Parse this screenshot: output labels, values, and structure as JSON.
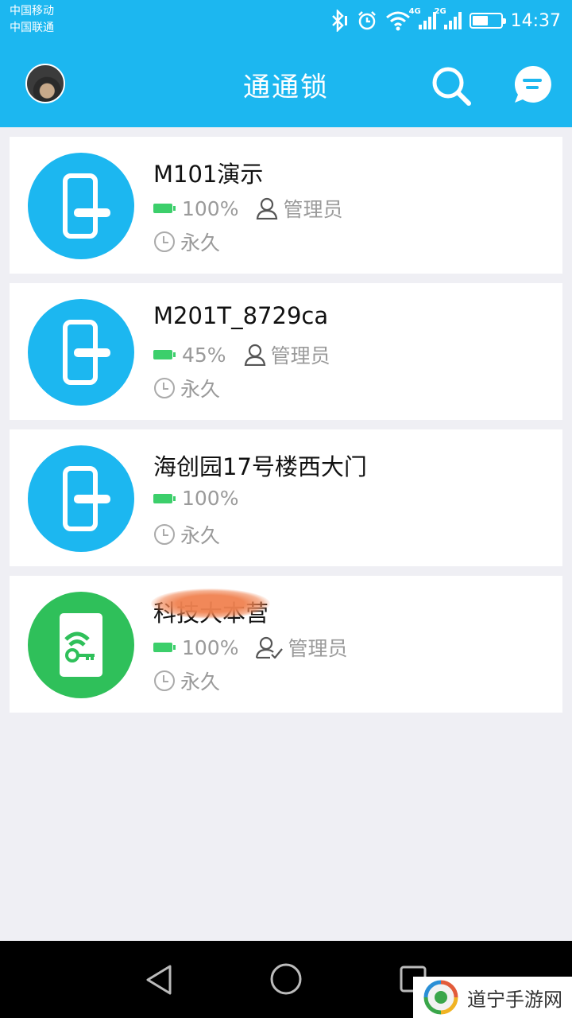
{
  "status_bar": {
    "carrier_1": "中国移动",
    "carrier_2": "中国联通",
    "network_1": "4G",
    "network_2": "2G",
    "time": "14:37",
    "battery_level": 0.55,
    "icons": [
      "bluetooth-icon",
      "alarm-icon",
      "wifi-icon",
      "signal-icon",
      "battery-icon"
    ]
  },
  "app_bar": {
    "title": "通通锁",
    "left_icon": "avatar",
    "right_icons": [
      "search-icon",
      "message-icon"
    ]
  },
  "locks": [
    {
      "name": "M101演示",
      "battery": "100%",
      "role": "管理员",
      "validity": "永久",
      "icon": "door-lock-icon",
      "color": "#1cb7f0"
    },
    {
      "name": "M201T_8729ca",
      "battery": "45%",
      "role": "管理员",
      "validity": "永久",
      "icon": "door-lock-icon",
      "color": "#1cb7f0"
    },
    {
      "name": "海创园17号楼西大门",
      "battery": "100%",
      "role": "",
      "validity": "永久",
      "icon": "door-lock-icon",
      "color": "#1cb7f0"
    },
    {
      "name": "科技大本营",
      "battery": "100%",
      "role": "管理员",
      "validity": "永久",
      "icon": "wireless-key-icon",
      "color": "#2fc05a"
    }
  ],
  "nav_bar": {
    "icons": [
      "back-icon",
      "home-icon",
      "recent-apps-icon"
    ]
  },
  "watermark": {
    "text": "道宁手游网"
  },
  "colors": {
    "primary": "#1cb7f0",
    "battery_green": "#3ccf6b",
    "gateway_green": "#2fc05a",
    "background": "#efeff4"
  }
}
